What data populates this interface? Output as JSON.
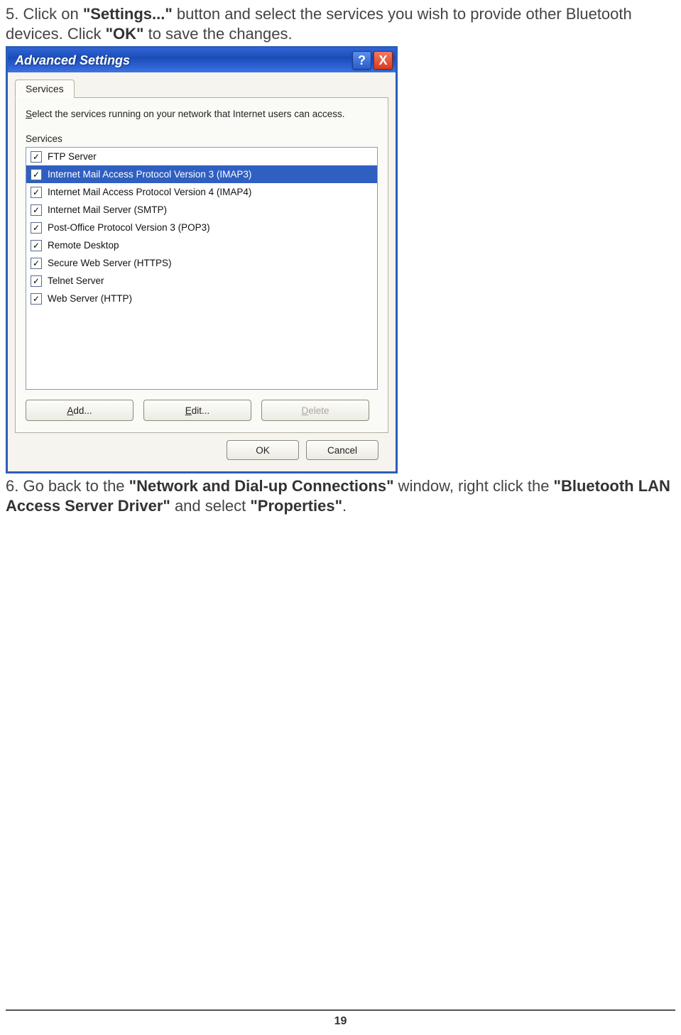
{
  "step5": {
    "prefix": "5. Click on ",
    "b1": "\"Settings...\"",
    "mid": " button and select the services you wish to provide other Bluetooth devices. Click ",
    "b2": "\"OK\"",
    "suffix": " to save the changes."
  },
  "dialog": {
    "title": "Advanced Settings",
    "help": "?",
    "close": "X",
    "tab": "Services",
    "desc_pre": "S",
    "desc_rest": "elect the services running on your network that Internet users can access.",
    "list_label": "Services",
    "services": [
      {
        "label": "FTP Server",
        "checked": true,
        "selected": false
      },
      {
        "label": "Internet Mail Access Protocol Version 3 (IMAP3)",
        "checked": true,
        "selected": true
      },
      {
        "label": "Internet Mail Access Protocol Version 4 (IMAP4)",
        "checked": true,
        "selected": false
      },
      {
        "label": "Internet Mail Server (SMTP)",
        "checked": true,
        "selected": false
      },
      {
        "label": "Post-Office Protocol Version 3 (POP3)",
        "checked": true,
        "selected": false
      },
      {
        "label": "Remote Desktop",
        "checked": true,
        "selected": false
      },
      {
        "label": "Secure Web Server (HTTPS)",
        "checked": true,
        "selected": false
      },
      {
        "label": "Telnet Server",
        "checked": true,
        "selected": false
      },
      {
        "label": "Web Server (HTTP)",
        "checked": true,
        "selected": false
      }
    ],
    "buttons": {
      "add_pre": "A",
      "add_rest": "dd...",
      "edit_pre": "E",
      "edit_rest": "dit...",
      "delete_pre": "D",
      "delete_rest": "elete",
      "ok": "OK",
      "cancel": "Cancel"
    }
  },
  "step6": {
    "prefix": "6. Go back to the ",
    "b1": "\"Network and Dial-up Connections\"",
    "mid1": " window, right click the ",
    "b2": "\"Bluetooth LAN Access Server Driver\"",
    "mid2": " and select ",
    "b3": "\"Properties\"",
    "suffix": "."
  },
  "page_number": "19"
}
